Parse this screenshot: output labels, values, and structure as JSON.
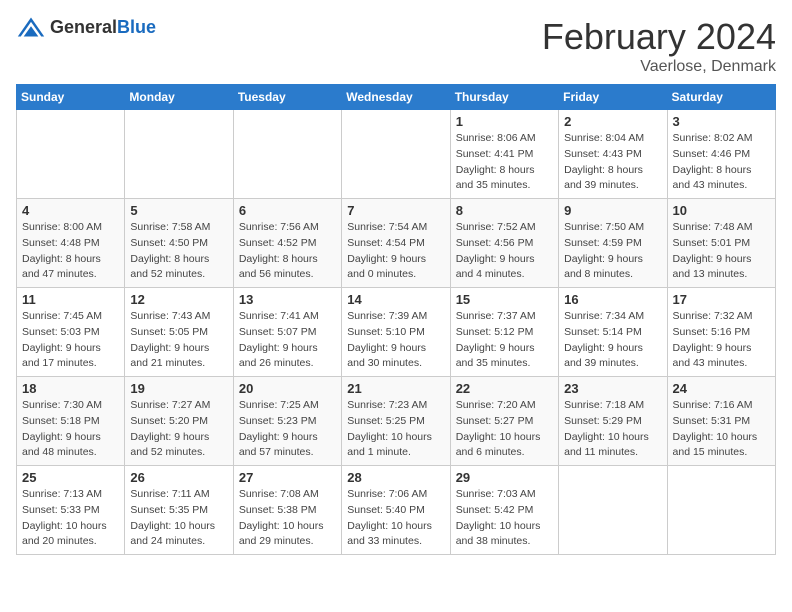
{
  "header": {
    "logo": {
      "general": "General",
      "blue": "Blue"
    },
    "title": "February 2024",
    "location": "Vaerlose, Denmark"
  },
  "calendar": {
    "days_of_week": [
      "Sunday",
      "Monday",
      "Tuesday",
      "Wednesday",
      "Thursday",
      "Friday",
      "Saturday"
    ],
    "weeks": [
      [
        {
          "day": "",
          "info": ""
        },
        {
          "day": "",
          "info": ""
        },
        {
          "day": "",
          "info": ""
        },
        {
          "day": "",
          "info": ""
        },
        {
          "day": "1",
          "info": "Sunrise: 8:06 AM\nSunset: 4:41 PM\nDaylight: 8 hours\nand 35 minutes."
        },
        {
          "day": "2",
          "info": "Sunrise: 8:04 AM\nSunset: 4:43 PM\nDaylight: 8 hours\nand 39 minutes."
        },
        {
          "day": "3",
          "info": "Sunrise: 8:02 AM\nSunset: 4:46 PM\nDaylight: 8 hours\nand 43 minutes."
        }
      ],
      [
        {
          "day": "4",
          "info": "Sunrise: 8:00 AM\nSunset: 4:48 PM\nDaylight: 8 hours\nand 47 minutes."
        },
        {
          "day": "5",
          "info": "Sunrise: 7:58 AM\nSunset: 4:50 PM\nDaylight: 8 hours\nand 52 minutes."
        },
        {
          "day": "6",
          "info": "Sunrise: 7:56 AM\nSunset: 4:52 PM\nDaylight: 8 hours\nand 56 minutes."
        },
        {
          "day": "7",
          "info": "Sunrise: 7:54 AM\nSunset: 4:54 PM\nDaylight: 9 hours\nand 0 minutes."
        },
        {
          "day": "8",
          "info": "Sunrise: 7:52 AM\nSunset: 4:56 PM\nDaylight: 9 hours\nand 4 minutes."
        },
        {
          "day": "9",
          "info": "Sunrise: 7:50 AM\nSunset: 4:59 PM\nDaylight: 9 hours\nand 8 minutes."
        },
        {
          "day": "10",
          "info": "Sunrise: 7:48 AM\nSunset: 5:01 PM\nDaylight: 9 hours\nand 13 minutes."
        }
      ],
      [
        {
          "day": "11",
          "info": "Sunrise: 7:45 AM\nSunset: 5:03 PM\nDaylight: 9 hours\nand 17 minutes."
        },
        {
          "day": "12",
          "info": "Sunrise: 7:43 AM\nSunset: 5:05 PM\nDaylight: 9 hours\nand 21 minutes."
        },
        {
          "day": "13",
          "info": "Sunrise: 7:41 AM\nSunset: 5:07 PM\nDaylight: 9 hours\nand 26 minutes."
        },
        {
          "day": "14",
          "info": "Sunrise: 7:39 AM\nSunset: 5:10 PM\nDaylight: 9 hours\nand 30 minutes."
        },
        {
          "day": "15",
          "info": "Sunrise: 7:37 AM\nSunset: 5:12 PM\nDaylight: 9 hours\nand 35 minutes."
        },
        {
          "day": "16",
          "info": "Sunrise: 7:34 AM\nSunset: 5:14 PM\nDaylight: 9 hours\nand 39 minutes."
        },
        {
          "day": "17",
          "info": "Sunrise: 7:32 AM\nSunset: 5:16 PM\nDaylight: 9 hours\nand 43 minutes."
        }
      ],
      [
        {
          "day": "18",
          "info": "Sunrise: 7:30 AM\nSunset: 5:18 PM\nDaylight: 9 hours\nand 48 minutes."
        },
        {
          "day": "19",
          "info": "Sunrise: 7:27 AM\nSunset: 5:20 PM\nDaylight: 9 hours\nand 52 minutes."
        },
        {
          "day": "20",
          "info": "Sunrise: 7:25 AM\nSunset: 5:23 PM\nDaylight: 9 hours\nand 57 minutes."
        },
        {
          "day": "21",
          "info": "Sunrise: 7:23 AM\nSunset: 5:25 PM\nDaylight: 10 hours\nand 1 minute."
        },
        {
          "day": "22",
          "info": "Sunrise: 7:20 AM\nSunset: 5:27 PM\nDaylight: 10 hours\nand 6 minutes."
        },
        {
          "day": "23",
          "info": "Sunrise: 7:18 AM\nSunset: 5:29 PM\nDaylight: 10 hours\nand 11 minutes."
        },
        {
          "day": "24",
          "info": "Sunrise: 7:16 AM\nSunset: 5:31 PM\nDaylight: 10 hours\nand 15 minutes."
        }
      ],
      [
        {
          "day": "25",
          "info": "Sunrise: 7:13 AM\nSunset: 5:33 PM\nDaylight: 10 hours\nand 20 minutes."
        },
        {
          "day": "26",
          "info": "Sunrise: 7:11 AM\nSunset: 5:35 PM\nDaylight: 10 hours\nand 24 minutes."
        },
        {
          "day": "27",
          "info": "Sunrise: 7:08 AM\nSunset: 5:38 PM\nDaylight: 10 hours\nand 29 minutes."
        },
        {
          "day": "28",
          "info": "Sunrise: 7:06 AM\nSunset: 5:40 PM\nDaylight: 10 hours\nand 33 minutes."
        },
        {
          "day": "29",
          "info": "Sunrise: 7:03 AM\nSunset: 5:42 PM\nDaylight: 10 hours\nand 38 minutes."
        },
        {
          "day": "",
          "info": ""
        },
        {
          "day": "",
          "info": ""
        }
      ]
    ]
  }
}
